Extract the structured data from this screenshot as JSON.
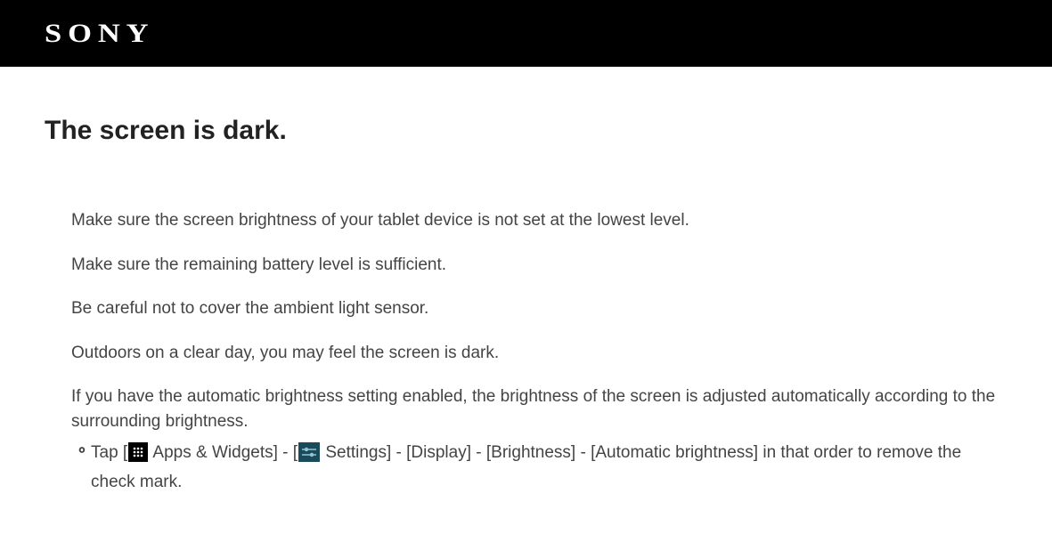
{
  "header": {
    "logo_text": "SONY"
  },
  "page": {
    "title": "The screen is dark."
  },
  "tips": [
    "Make sure the screen brightness of your tablet device is not set at the lowest level.",
    "Make sure the remaining battery level is sufficient.",
    "Be careful not to cover the ambient light sensor.",
    "Outdoors on a clear day, you may feel the screen is dark.",
    "If you have the automatic brightness setting enabled, the brightness of the screen is adjusted automatically according to the surrounding brightness."
  ],
  "subtip": {
    "prefix": "Tap [",
    "apps_label": " Apps & Widgets] - [",
    "settings_label": " Settings] - [Display] - [Brightness] - [Automatic brightness] in that order to remove the check mark."
  }
}
